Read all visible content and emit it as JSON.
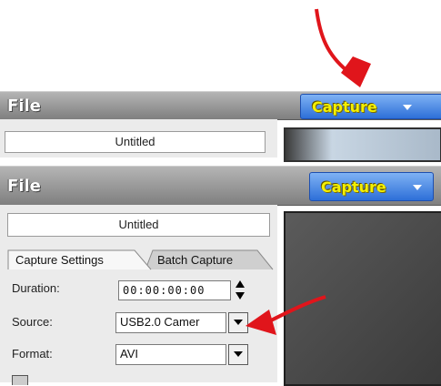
{
  "top": {
    "menu_file": "File",
    "capture_label": "Capture",
    "title_field": "Untitled"
  },
  "bottom": {
    "menu_file": "File",
    "capture_label": "Capture",
    "title_field": "Untitled",
    "tabs": [
      "Capture Settings",
      "Batch Capture"
    ],
    "duration_label": "Duration:",
    "duration_value": "00:00:00:00",
    "source_label": "Source:",
    "source_value": "USB2.0 Camer",
    "format_label": "Format:",
    "format_value": "AVI"
  },
  "colors": {
    "annotation_arrow": "#e0151b",
    "capture_button": "#3f82e8",
    "capture_text": "#f4f000"
  }
}
